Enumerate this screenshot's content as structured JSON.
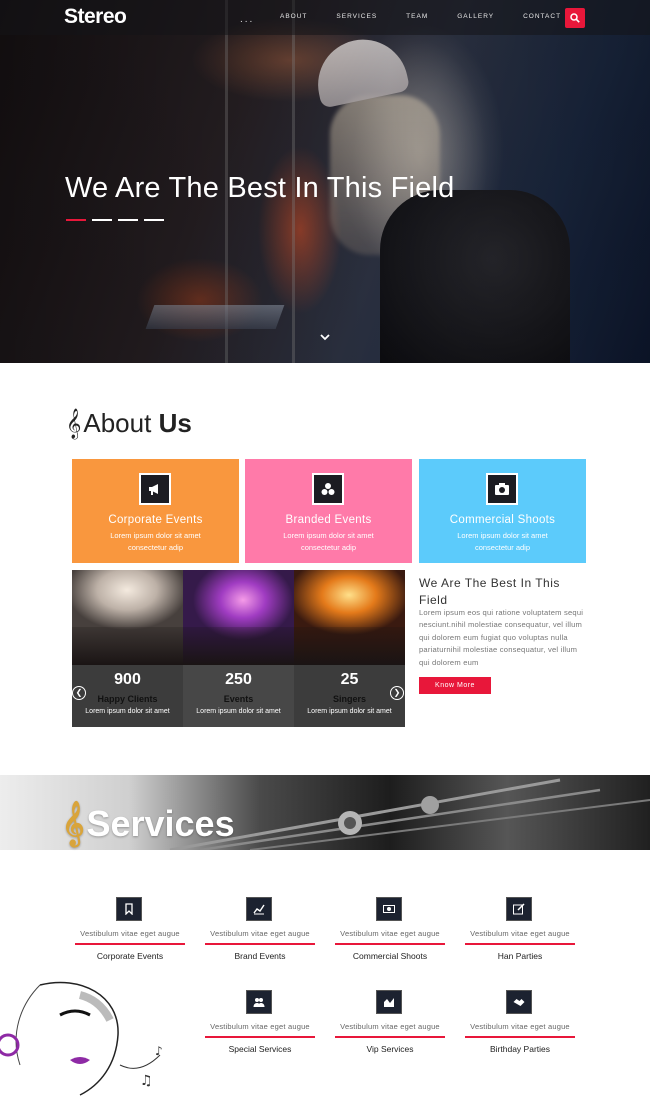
{
  "nav": {
    "logo": "Stereo",
    "dots": "...",
    "items": [
      "ABOUT",
      "SERVICES",
      "TEAM",
      "GALLERY",
      "CONTACT"
    ]
  },
  "hero": {
    "title": "We Are The Best In This Field"
  },
  "about": {
    "title_light": "About",
    "title_bold": "Us",
    "cards": [
      {
        "title": "Corporate Events",
        "line1": "Lorem ipsum dolor sit amet",
        "line2": "consectetur adip",
        "color": "#f9973e",
        "icon": "megaphone-icon"
      },
      {
        "title": "Branded Events",
        "line1": "Lorem ipsum dolor sit amet",
        "line2": "consectetur adip",
        "color": "#ff7aa9",
        "icon": "boxes-icon"
      },
      {
        "title": "Commercial Shoots",
        "line1": "Lorem ipsum dolor sit amet",
        "line2": "consectetur adip",
        "color": "#5ccbfb",
        "icon": "camera-icon"
      }
    ],
    "stats": [
      {
        "number": "900",
        "label": "Happy Clients",
        "sub": "Lorem ipsum dolor sit amet"
      },
      {
        "number": "250",
        "label": "Events",
        "sub": "Lorem ipsum dolor sit amet"
      },
      {
        "number": "25",
        "label": "Singers",
        "sub": "Lorem ipsum dolor sit amet"
      }
    ],
    "side_title": "We Are The Best In This Field",
    "side_text": "Lorem ipsum eos qui ratione voluptatem sequi nesciunt.nihil molestiae consequatur, vel illum qui dolorem eum fugiat quo voluptas nulla pariaturnihil molestiae consequatur, vel illum qui dolorem eum",
    "button": "Know More"
  },
  "services": {
    "title": "Services",
    "items": [
      {
        "desc": "Vestibulum vitae eget augue",
        "name": "Corporate Events",
        "icon": "bookmark-icon"
      },
      {
        "desc": "Vestibulum vitae eget augue",
        "name": "Brand Events",
        "icon": "line-chart-icon"
      },
      {
        "desc": "Vestibulum vitae eget augue",
        "name": "Commercial Shoots",
        "icon": "money-icon"
      },
      {
        "desc": "Vestibulum vitae eget augue",
        "name": "Han Parties",
        "icon": "edit-icon"
      },
      {
        "desc": "Vestibulum vitae eget augue",
        "name": "Special Services",
        "icon": "users-icon"
      },
      {
        "desc": "Vestibulum vitae eget augue",
        "name": "Vip Services",
        "icon": "area-chart-icon"
      },
      {
        "desc": "Vestibulum vitae eget augue",
        "name": "Birthday Parties",
        "icon": "handshake-icon"
      }
    ]
  },
  "colors": {
    "accent": "#e8173a"
  }
}
